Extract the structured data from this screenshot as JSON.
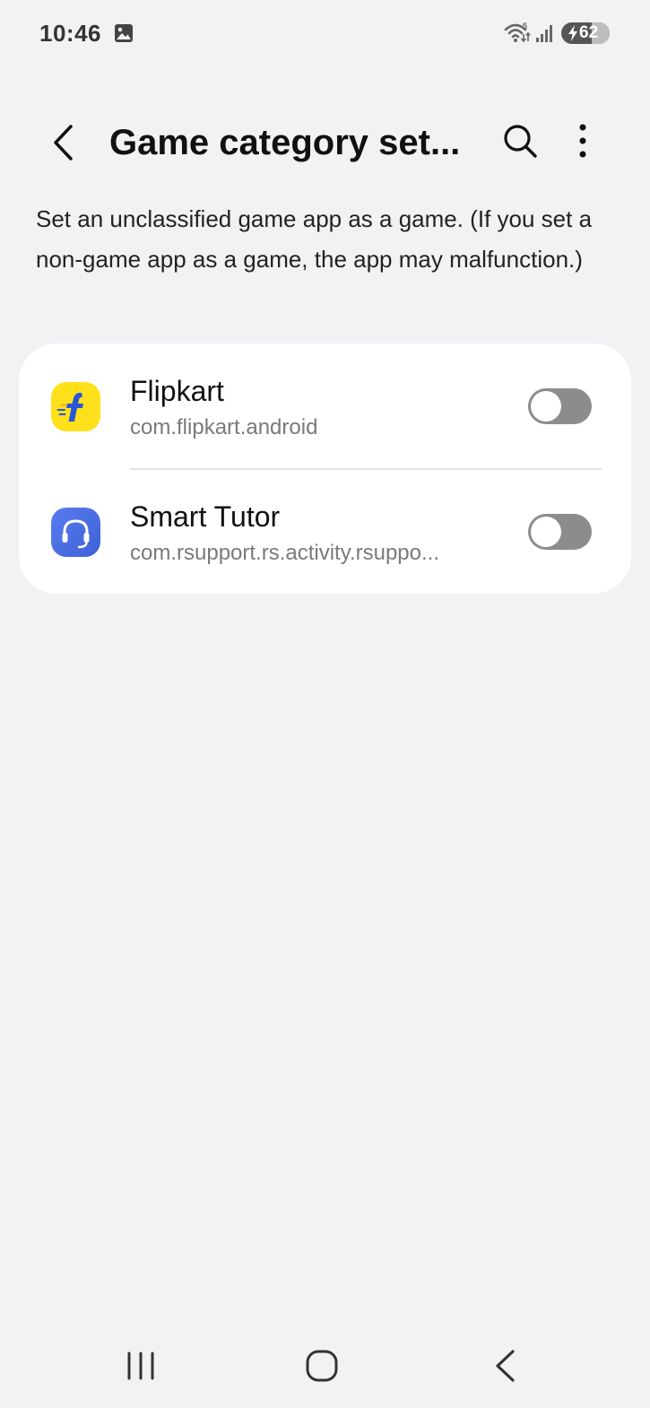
{
  "status_bar": {
    "time": "10:46",
    "battery_level": "62",
    "icons": [
      "gallery-icon",
      "wifi-icon",
      "signal-icon",
      "battery-charging-icon"
    ]
  },
  "app_bar": {
    "title": "Game category set...",
    "icons": [
      "back-arrow-icon",
      "search-icon",
      "more-options-icon"
    ]
  },
  "description": "Set an unclassified game app as a game. (If you set a non-game app as a game, the app may malfunction.)",
  "apps": [
    {
      "name": "Flipkart",
      "package": "com.flipkart.android",
      "icon": "flipkart-app-icon",
      "enabled": false
    },
    {
      "name": "Smart Tutor",
      "package": "com.rsupport.rs.activity.rsuppo...",
      "icon": "smart-tutor-app-icon",
      "enabled": false
    }
  ],
  "colors": {
    "background": "#f2f2f4",
    "card": "#ffffff",
    "toggle_off": "#8c8c8c",
    "flipkart_yellow": "#ffe11b",
    "flipkart_blue": "#2a55d8",
    "tutor_blue": "#4a6ee6"
  },
  "nav_bar": {
    "icons": [
      "recents-icon",
      "home-icon",
      "nav-back-icon"
    ]
  }
}
